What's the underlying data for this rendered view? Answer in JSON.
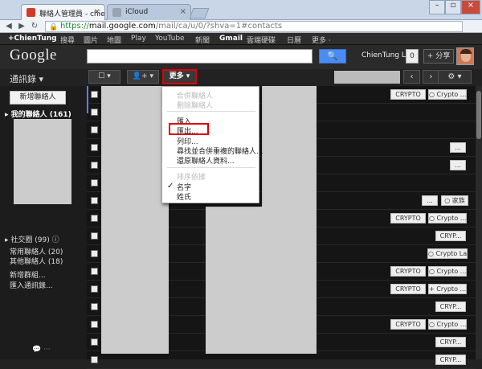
{
  "browser": {
    "tabs": [
      {
        "label": "聯絡人管理員 - chie",
        "favicon_color": "#d33a2c"
      },
      {
        "label": "iCloud",
        "favicon_color": "#9aa4b1"
      }
    ],
    "url": {
      "scheme": "https://",
      "host": "mail.google.com",
      "path": "/mail/ca/u/0/?shva=1#contacts"
    }
  },
  "gbar": {
    "user": "+ChienTung",
    "items": [
      "搜尋",
      "圖片",
      "地圖",
      "Play",
      "YouTube",
      "新聞",
      "Gmail",
      "雲端硬碟",
      "日曆",
      "更多 ·"
    ]
  },
  "header": {
    "logo": "Google",
    "search_placeholder": "",
    "search_button": "🔍",
    "username": "ChienTung Lu",
    "notifications": "0",
    "share": "+ 分享"
  },
  "toolbar": {
    "title": "通訊錄 ▾",
    "select_btn": "☐ ▾",
    "add_btn": "👤+ ▾",
    "more_btn": "更多 ▾",
    "prev": "‹",
    "next": "›",
    "settings": "⚙ ▾"
  },
  "sidebar": {
    "new_contact": "新增聯絡人",
    "my_contacts": "▸ 我的聯絡人 (161)",
    "circles": "▸ 社交圈 (99) ⓘ",
    "frequent": "常用聯絡人 (20)",
    "other": "其他聯絡人 (18)",
    "new_group": "新增群組...",
    "import": "匯入通訊錄...",
    "bottom_icons": "💬  ···"
  },
  "menu": {
    "merge": "合併聯絡人",
    "delete": "刪除聯絡人",
    "import": "匯入...",
    "export": "匯出...",
    "print": "列印...",
    "find_dupes": "尋找並合併重複的聯絡人...",
    "restore": "還原聯絡人資料...",
    "sort_header": "排序依據",
    "sort_first": "名字",
    "sort_last": "姓氏",
    "checkmark": "✓"
  },
  "rows": [
    {
      "tags": [
        "CRYPTO",
        "○ Crypto ..."
      ]
    },
    {
      "tags": []
    },
    {
      "tags": []
    },
    {
      "tags": [
        "..."
      ]
    },
    {
      "tags": [
        "..."
      ]
    },
    {
      "tags": []
    },
    {
      "tags": [
        "...",
        "○ 家族"
      ]
    },
    {
      "tags": [
        "CRYPTO",
        "○ Crypto ..."
      ]
    },
    {
      "tags": [
        "CRYP..."
      ]
    },
    {
      "tags": [
        "○ Crypto Lab"
      ]
    },
    {
      "tags": [
        "CRYPTO",
        "○ Crypto ..."
      ]
    },
    {
      "tags": [
        "CRYPTO",
        "+ Crypto ..."
      ]
    },
    {
      "tags": [
        "CRYP..."
      ]
    },
    {
      "tags": [
        "CRYPTO",
        "○ Crypto ..."
      ]
    },
    {
      "tags": [
        "CRYP..."
      ]
    },
    {
      "tags": [
        "CRYP..."
      ]
    }
  ]
}
